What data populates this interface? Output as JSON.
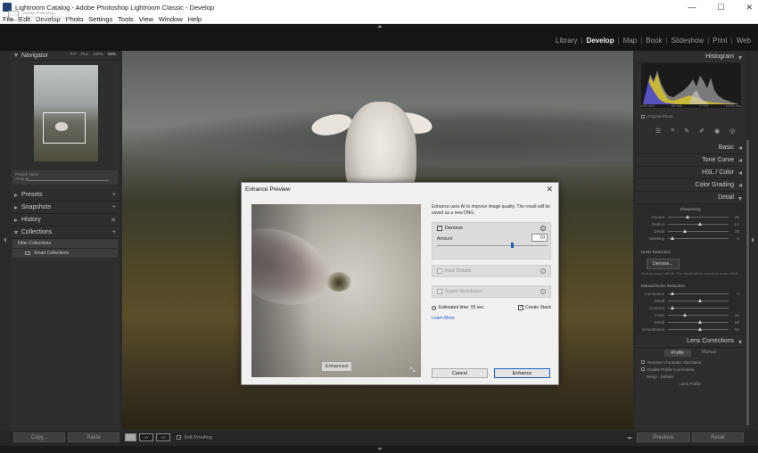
{
  "window": {
    "title": "Lightroom Catalog - Adobe Photoshop Lightroom Classic - Develop",
    "controls": [
      "—",
      "☐",
      "✕"
    ]
  },
  "menu": [
    "File",
    "Edit",
    "Develop",
    "Photo",
    "Settings",
    "Tools",
    "View",
    "Window",
    "Help"
  ],
  "identity": {
    "logo": "Lrc",
    "line1": "Adobe Photoshop",
    "line2": "Lightroom Classic"
  },
  "modules": {
    "items": [
      "Library",
      "Develop",
      "Map",
      "Book",
      "Slideshow",
      "Print",
      "Web"
    ],
    "active": "Develop"
  },
  "left_panel": {
    "navigator": {
      "title": "Navigator",
      "zoom_options": [
        "FIT",
        "FILL",
        "100%",
        "50%"
      ],
      "active_zoom": "50%"
    },
    "preset_bar": {
      "label": "Preset: None",
      "sublabel": "Amount"
    },
    "sections": [
      {
        "title": "Presets",
        "plus": "+"
      },
      {
        "title": "Snapshots",
        "plus": "+"
      },
      {
        "title": "History",
        "plus": "✕"
      },
      {
        "title": "Collections",
        "plus": "+"
      }
    ],
    "collections": [
      {
        "label": "Filter Collections"
      },
      {
        "label": "Smart Collections"
      }
    ]
  },
  "histogram": {
    "title": "Histogram",
    "info": [
      "ISO 100",
      "60 mm",
      "f / 5.6",
      "1/250 sec"
    ],
    "original_photo": "Original Photo"
  },
  "right_panel": {
    "sections": [
      "Basic",
      "Tone Curve",
      "HSL / Color",
      "Color Grading",
      "Detail"
    ],
    "sharpening": {
      "title": "Sharpening",
      "sliders": [
        {
          "label": "Amount",
          "value": "40",
          "pos": 0.3
        },
        {
          "label": "Radius",
          "value": "1.0",
          "pos": 0.5
        },
        {
          "label": "Detail",
          "value": "25",
          "pos": 0.25
        },
        {
          "label": "Masking",
          "value": "0",
          "pos": 0.05
        }
      ]
    },
    "noise_reduction": {
      "title": "Noise Reduction",
      "button": "Denoise...",
      "desc": "Reduce noise with AI. The result will be saved as a new DNG.",
      "manual_title": "Manual Noise Reduction",
      "sliders": [
        {
          "label": "Luminance",
          "value": "0",
          "pos": 0.05
        },
        {
          "label": "Detail",
          "value": "",
          "pos": 0.5
        },
        {
          "label": "Contrast",
          "value": "",
          "pos": 0.05
        },
        {
          "label": "Color",
          "value": "25",
          "pos": 0.25
        },
        {
          "label": "Detail",
          "value": "50",
          "pos": 0.5
        },
        {
          "label": "Smoothness",
          "value": "50",
          "pos": 0.5
        }
      ]
    },
    "lens_corrections": {
      "title": "Lens Corrections",
      "tabs": [
        "Profile",
        "Manual"
      ],
      "active_tab": "Profile",
      "checks": [
        "Remove Chromatic Aberration",
        "Enable Profile Corrections"
      ],
      "setup": "Setup : Default",
      "lens_profile": "Lens Profile"
    }
  },
  "bottom": {
    "copy": "Copy...",
    "paste": "Paste",
    "soft_proofing": "Soft Proofing",
    "view_labels": [
      "XY",
      "Y|Y"
    ],
    "previous": "Previous",
    "reset": "Reset"
  },
  "dialog": {
    "title": "Enhance Preview",
    "close": "✕",
    "description": "Enhance uses AI to improve image quality. The result will be saved as a new DNG.",
    "preview_label": "Enhanced",
    "denoise": {
      "label": "Denoise",
      "checked": true,
      "amount_label": "Amount",
      "amount_value": "70",
      "amount_frac": 0.7
    },
    "raw_details": {
      "label": "Raw Details",
      "checked": false
    },
    "super_resolution": {
      "label": "Super Resolution",
      "checked": false
    },
    "estimated_time": "Estimated time: 55 sec.",
    "create_stack": "Create Stack",
    "create_stack_checked": true,
    "learn_more": "Learn More",
    "cancel": "Cancel",
    "enhance": "Enhance",
    "check_mark": "✓",
    "info_mark": "i"
  },
  "colors": {
    "accent": "#1f5fbf",
    "panel_bg": "#2e2e2e"
  }
}
